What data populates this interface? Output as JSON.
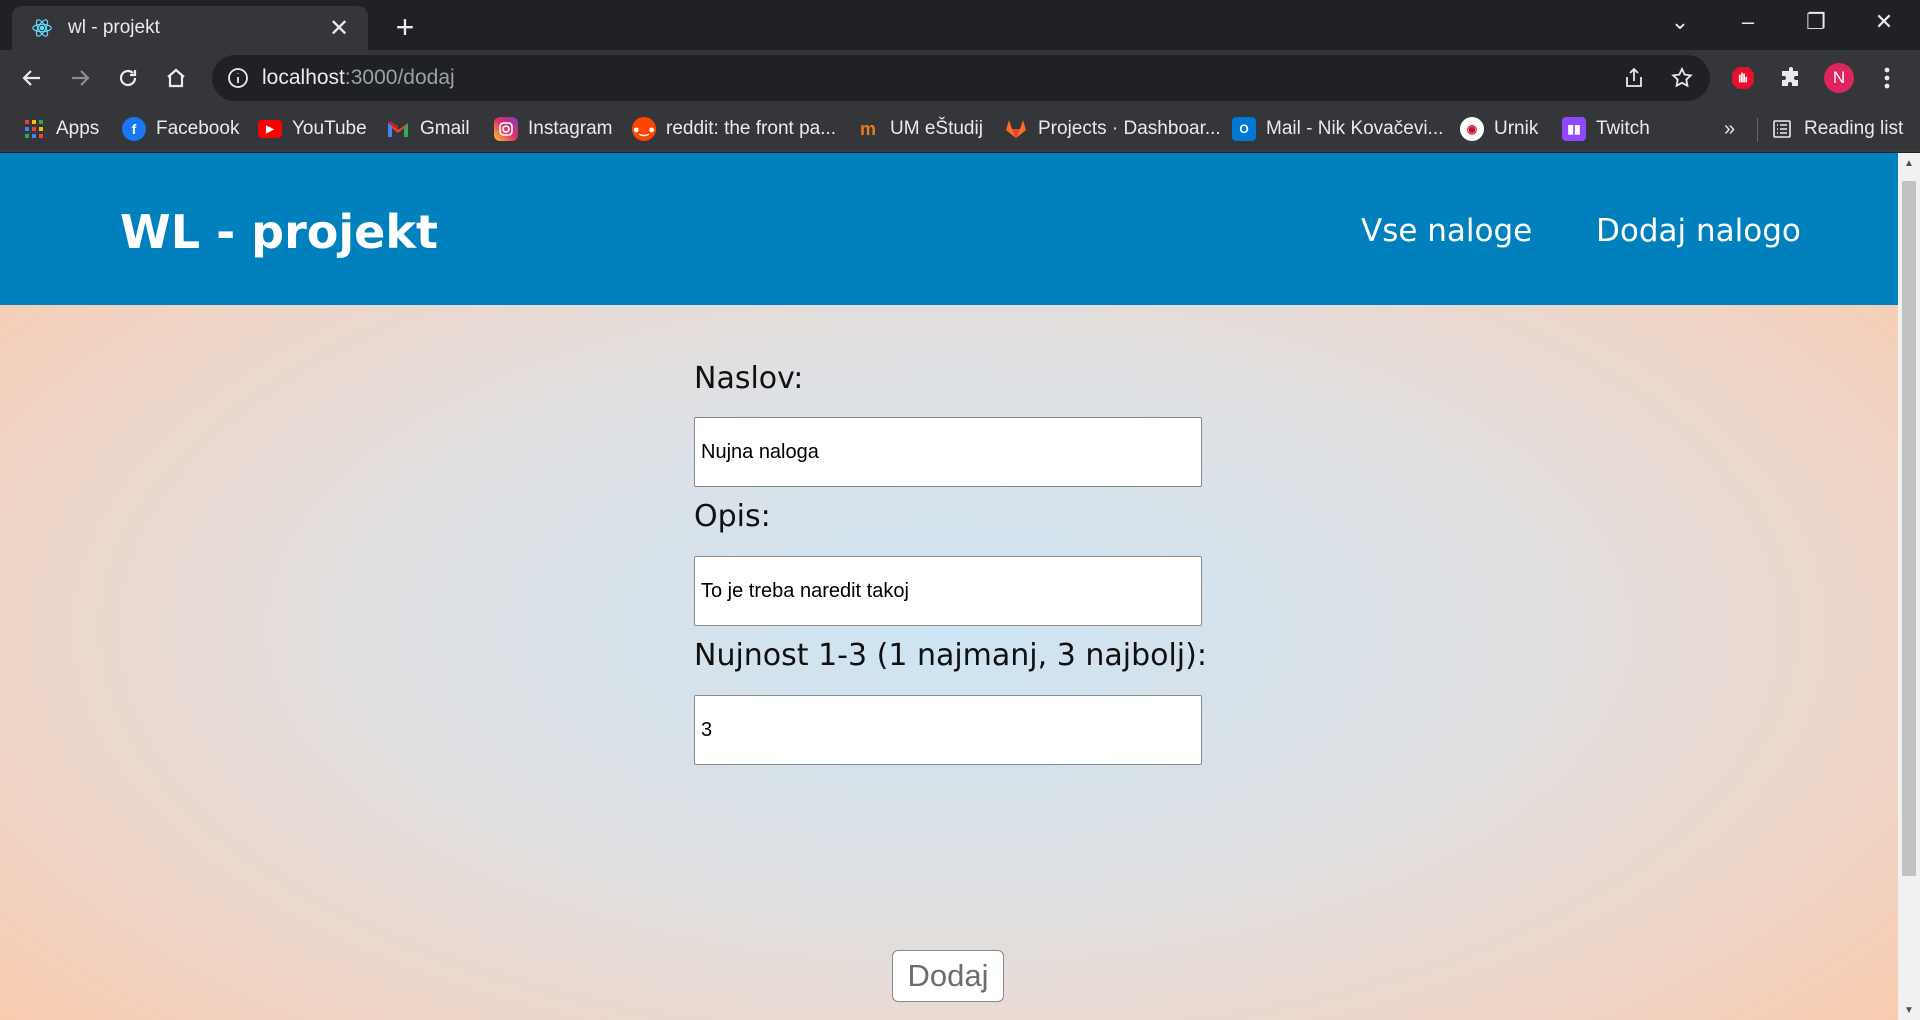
{
  "browser": {
    "tab": {
      "title": "wl - projekt",
      "close": "✕",
      "new_tab": "+"
    },
    "window": {
      "dropdown": "⌄",
      "minimize": "–",
      "restore": "❐",
      "close": "✕"
    },
    "address": {
      "host": "localhost",
      "path": ":3000/dodaj"
    },
    "profile_initial": "N",
    "bookmarks": [
      {
        "label": "Apps",
        "icon": "apps-grid-icon"
      },
      {
        "label": "Facebook",
        "icon": "facebook-icon"
      },
      {
        "label": "YouTube",
        "icon": "youtube-icon"
      },
      {
        "label": "Gmail",
        "icon": "gmail-icon"
      },
      {
        "label": "Instagram",
        "icon": "instagram-icon"
      },
      {
        "label": "reddit: the front pa...",
        "icon": "reddit-icon"
      },
      {
        "label": "UM eŠtudij",
        "icon": "um-icon"
      },
      {
        "label": "Projects · Dashboar...",
        "icon": "gitlab-icon"
      },
      {
        "label": "Mail - Nik Kovačevi...",
        "icon": "outlook-icon"
      },
      {
        "label": "Urnik",
        "icon": "urnik-icon"
      },
      {
        "label": "Twitch",
        "icon": "twitch-icon"
      }
    ],
    "bookmarks_overflow": "»",
    "reading_list": "Reading list"
  },
  "site": {
    "brand": "WL - projekt",
    "nav": [
      "Vse naloge",
      "Dodaj nalogo"
    ]
  },
  "form": {
    "title_label": "Naslov:",
    "title_value": "Nujna naloga",
    "desc_label": "Opis:",
    "desc_value": "To je treba naredit takoj",
    "priority_label": "Nujnost 1-3 (1 najmanj, 3 najbolj):",
    "priority_value": "3",
    "submit_label": "Dodaj"
  },
  "colors": {
    "header": "#0081bd",
    "chrome_dark": "#202124",
    "chrome_toolbar": "#35363a",
    "profile": "#e0245e"
  }
}
